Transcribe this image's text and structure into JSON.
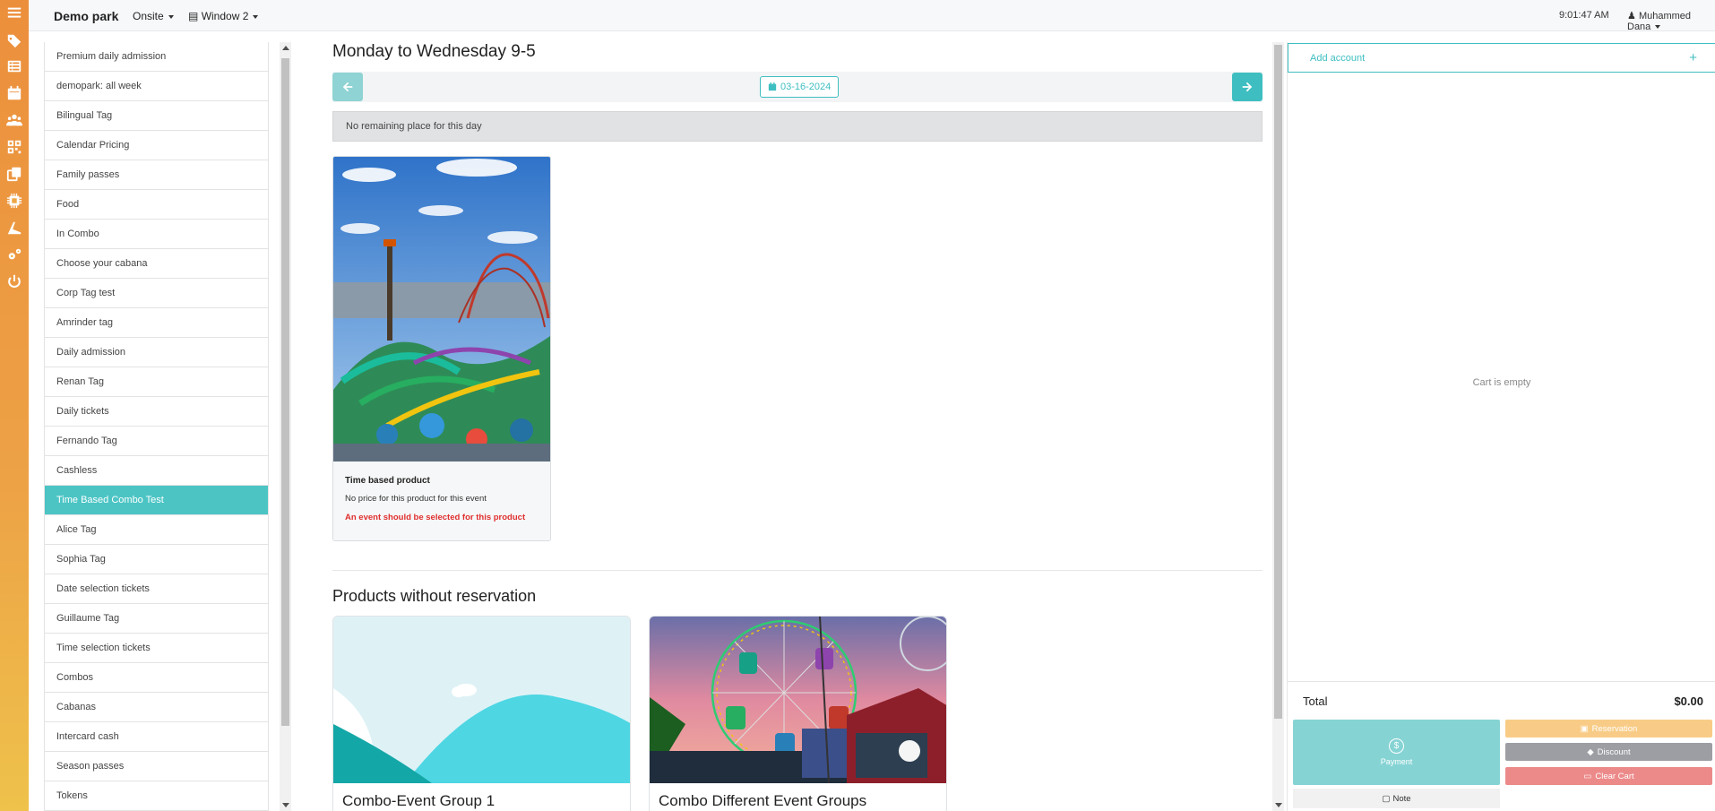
{
  "rail": {
    "icons": [
      "menu-icon",
      "tag-icon",
      "list-icon",
      "calendar-icon",
      "users-icon",
      "qrcode-icon",
      "copy-icon",
      "chip-icon",
      "ride-icon",
      "settings-icon",
      "power-icon"
    ]
  },
  "topbar": {
    "park_name": "Demo park",
    "mode": "Onsite",
    "window": "Window 2",
    "time": "9:01:47 AM",
    "user": "Muhammed Dana"
  },
  "categories": [
    "Premium daily admission",
    "demopark: all week",
    "Bilingual Tag",
    "Calendar Pricing",
    "Family passes",
    "Food",
    "In Combo",
    "Choose your cabana",
    "Corp Tag test",
    "Amrinder tag",
    "Daily admission",
    "Renan Tag",
    "Daily tickets",
    "Fernando Tag",
    "Cashless",
    "Time Based Combo Test",
    "Alice Tag",
    "Sophia Tag",
    "Date selection tickets",
    "Guillaume Tag",
    "Time selection tickets",
    "Combos",
    "Cabanas",
    "Intercard cash",
    "Season passes",
    "Tokens"
  ],
  "active_category": "Time Based Combo Test",
  "main": {
    "event_title": "Monday to Wednesday 9-5",
    "date": "03-16-2024",
    "notice": "No remaining place for this day",
    "product": {
      "title": "Time based product",
      "price_note": "No price for this product for this event",
      "warning": "An event should be selected for this product"
    },
    "section_title": "Products without reservation",
    "cards": [
      {
        "title": "Combo-Event Group 1"
      },
      {
        "title": "Combo Different Event Groups"
      }
    ]
  },
  "cart": {
    "add_account": "Add account",
    "empty_text": "Cart is empty",
    "total_label": "Total",
    "total_value": "$0.00",
    "payment": "Payment",
    "reservation": "Reservation",
    "discount": "Discount",
    "clear": "Clear Cart",
    "note": "Note"
  },
  "colors": {
    "accent": "#3fbec1",
    "active_row": "#4cc4c4",
    "rail_top": "#ec8f3c",
    "rail_bottom": "#eec24b",
    "error": "#e02f2f"
  }
}
